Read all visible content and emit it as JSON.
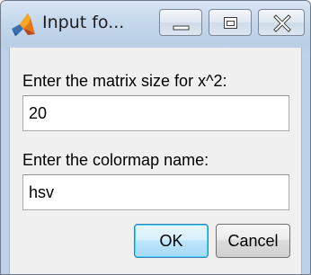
{
  "window": {
    "title": "Input fo..."
  },
  "caption_buttons": {
    "minimize": "minimize-icon",
    "maximize": "maximize-icon",
    "close": "close-icon"
  },
  "prompts": [
    {
      "label": "Enter the matrix size for x^2:",
      "value": "20"
    },
    {
      "label": "Enter the colormap name:",
      "value": "hsv"
    }
  ],
  "buttons": {
    "ok": "OK",
    "cancel": "Cancel"
  },
  "colors": {
    "default_button_border": "#3c7fb1",
    "titlebar": "#c6d8ec"
  }
}
